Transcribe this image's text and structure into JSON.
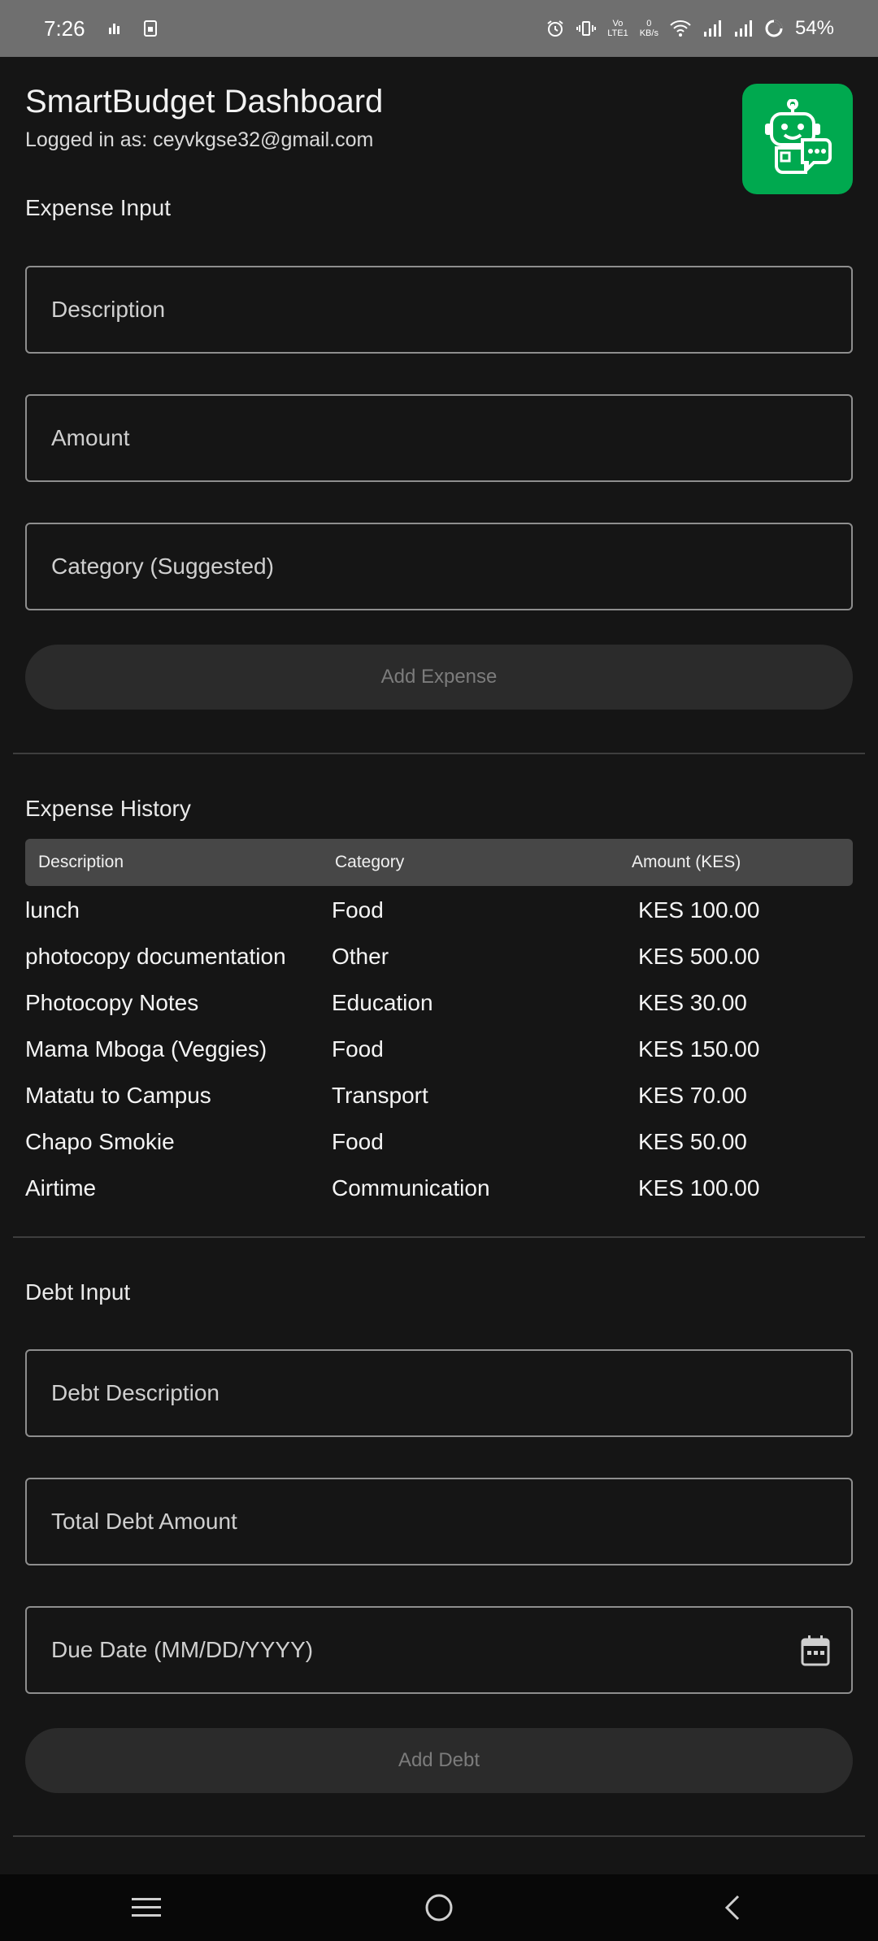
{
  "status_bar": {
    "time": "7:26",
    "battery": "54%",
    "net_speed_value": "0",
    "net_speed_unit": "KB/s",
    "volte": "Vo",
    "lte": "LTE1"
  },
  "header": {
    "title": "SmartBudget Dashboard",
    "logged_in": "Logged in as: ceyvkgse32@gmail.com",
    "assistant_icon": "robot-chat-icon",
    "accent_color": "#00a94f"
  },
  "expense_input": {
    "section_title": "Expense Input",
    "description_placeholder": "Description",
    "amount_placeholder": "Amount",
    "category_placeholder": "Category (Suggested)",
    "add_button": "Add Expense"
  },
  "expense_history": {
    "section_title": "Expense History",
    "columns": [
      "Description",
      "Category",
      "Amount (KES)"
    ],
    "rows": [
      {
        "description": "lunch",
        "category": "Food",
        "amount": "KES 100.00"
      },
      {
        "description": "photocopy documentation",
        "category": "Other",
        "amount": "KES 500.00"
      },
      {
        "description": "Photocopy Notes",
        "category": "Education",
        "amount": "KES 30.00"
      },
      {
        "description": "Mama Mboga (Veggies)",
        "category": "Food",
        "amount": "KES 150.00"
      },
      {
        "description": "Matatu to Campus",
        "category": "Transport",
        "amount": "KES 70.00"
      },
      {
        "description": "Chapo Smokie",
        "category": "Food",
        "amount": "KES 50.00"
      },
      {
        "description": "Airtime",
        "category": "Communication",
        "amount": "KES 100.00"
      }
    ]
  },
  "debt_input": {
    "section_title": "Debt Input",
    "description_placeholder": "Debt Description",
    "amount_placeholder": "Total Debt Amount",
    "due_date_placeholder": "Due Date (MM/DD/YYYY)",
    "add_button": "Add Debt"
  },
  "nav_bar": {
    "icons": [
      "recents-icon",
      "home-icon",
      "back-icon"
    ]
  }
}
